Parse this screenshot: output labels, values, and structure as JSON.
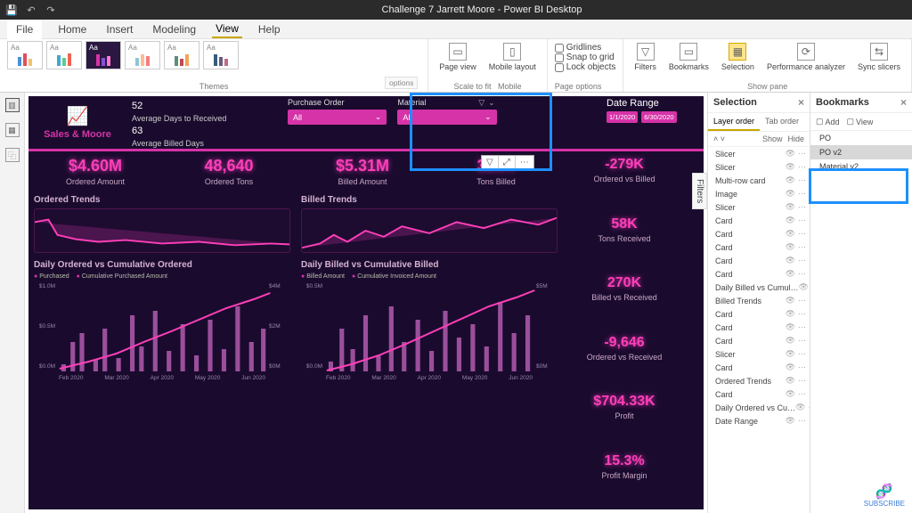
{
  "app": {
    "title": "Challenge 7 Jarrett Moore - Power BI Desktop"
  },
  "menu": {
    "file": "File",
    "tabs": [
      "Home",
      "Insert",
      "Modeling",
      "View",
      "Help"
    ],
    "active": "View"
  },
  "ribbon": {
    "themes_label": "Themes",
    "scale_label": "Scale to fit",
    "mobile_label": "Mobile",
    "page_view": "Page view",
    "mobile_layout": "Mobile layout",
    "gridlines": "Gridlines",
    "snap": "Snap to grid",
    "lock": "Lock objects",
    "page_options": "Page options",
    "filters": "Filters",
    "bookmarks": "Bookmarks",
    "selection": "Selection",
    "perf": "Performance analyzer",
    "sync": "Sync slicers",
    "show_pane": "Show pane",
    "options_tip": "options"
  },
  "canvas": {
    "brand": "Sales & Moore",
    "mrc": {
      "v1": "52",
      "l1": "Average Days to Received",
      "v2": "63",
      "l2": "Average Billed Days"
    },
    "po": {
      "title": "Purchase Order",
      "value": "All"
    },
    "mat": {
      "title": "Material",
      "value": "All"
    },
    "date": {
      "title": "Date Range",
      "from": "1/1/2020",
      "to": "6/30/2020"
    },
    "kpi": {
      "ordered_amt": {
        "v": "$4.60M",
        "l": "Ordered Amount"
      },
      "ordered_tons": {
        "v": "48,640",
        "l": "Ordered Tons"
      },
      "billed_amt": {
        "v": "$5.31M",
        "l": "Billed Amount"
      },
      "tons_billed": {
        "v": "328K",
        "l": "Tons Billed"
      },
      "ord_vs_billed": {
        "v": "-279K",
        "l": "Ordered vs Billed"
      },
      "tons_received": {
        "v": "58K",
        "l": "Tons Received"
      },
      "billed_vs_recv": {
        "v": "270K",
        "l": "Billed vs Received"
      },
      "ord_vs_recv": {
        "v": "-9,646",
        "l": "Ordered vs Received"
      },
      "profit": {
        "v": "$704.33K",
        "l": "Profit"
      },
      "margin": {
        "v": "15.3%",
        "l": "Profit Margin"
      }
    },
    "trend1": {
      "title": "Ordered Trends"
    },
    "trend2": {
      "title": "Billed Trends"
    },
    "combo1": {
      "title": "Daily Ordered vs Cumulative Ordered",
      "leg1": "Purchased",
      "leg2": "Cumulative Purchased Amount",
      "yl": [
        "$1.0M",
        "$0.5M",
        "$0.0M"
      ],
      "yr": [
        "$4M",
        "$2M",
        "$0M"
      ],
      "x": [
        "Feb 2020",
        "Mar 2020",
        "Apr 2020",
        "May 2020",
        "Jun 2020"
      ]
    },
    "combo2": {
      "title": "Daily Billed vs Cumulative Billed",
      "leg1": "Billed Amount",
      "leg2": "Cumulative Invoiced Amount",
      "yl": [
        "$0.5M",
        "$0.0M"
      ],
      "yr": [
        "$5M",
        "$0M"
      ],
      "x": [
        "Feb 2020",
        "Mar 2020",
        "Apr 2020",
        "May 2020",
        "Jun 2020"
      ]
    },
    "filters_tab": "Filters"
  },
  "selection": {
    "title": "Selection",
    "tab1": "Layer order",
    "tab2": "Tab order",
    "show": "Show",
    "hide": "Hide",
    "items": [
      "Slicer",
      "Slicer",
      "Multi-row card",
      "Image",
      "Slicer",
      "Card",
      "Card",
      "Card",
      "Card",
      "Card",
      "Daily Billed vs Cumul…",
      "Billed Trends",
      "Card",
      "Card",
      "Card",
      "Slicer",
      "Card",
      "Ordered Trends",
      "Card",
      "Daily Ordered vs Cu…",
      "Date Range"
    ]
  },
  "bookmarks": {
    "title": "Bookmarks",
    "add": "Add",
    "view": "View",
    "items": [
      "PO",
      "PO v2",
      "Material v2"
    ],
    "selected": "PO v2"
  },
  "subscribe": "SUBSCRIBE"
}
